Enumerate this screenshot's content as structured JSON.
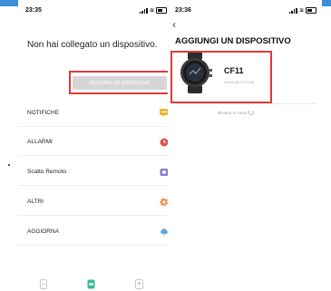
{
  "left_screen": {
    "status_time": "23:35",
    "no_device_title": "Non hai collegato un dispositivo.",
    "add_device_button": "AGGIUNGI UN DISPOSITIVO",
    "menu": [
      {
        "label": "NOTIFICHE",
        "icon": "message-icon",
        "color": "#f2b632"
      },
      {
        "label": "ALLARMI",
        "icon": "alarm-clock-icon",
        "color": "#e2514f"
      },
      {
        "label": "Scatto Remoto",
        "icon": "camera-icon",
        "color": "#8a78d6"
      },
      {
        "label": "ALTRI",
        "icon": "gear-icon",
        "color": "#f08a3c"
      },
      {
        "label": "AGGIORNA",
        "icon": "cloud-upload-icon",
        "color": "#5aa6e6"
      }
    ],
    "tabs": [
      {
        "name": "device",
        "icon": "device-icon"
      },
      {
        "name": "home",
        "icon": "dashboard-icon"
      },
      {
        "name": "profile",
        "icon": "profile-icon"
      }
    ]
  },
  "right_screen": {
    "status_time": "23:36",
    "back_glyph": "‹",
    "title": "AGGIUNGI UN DISPOSITIVO",
    "device": {
      "name": "CF11",
      "mac": "F8:83:66:75:C6:39",
      "image": "smartwatch-icon"
    },
    "searching_text": "Ricerca in corso"
  },
  "colors": {
    "highlight": "#e03a3a",
    "top_bar": "#3f8ed8",
    "disabled_button": "#d6d6d6",
    "tab_active": "#3bb89a"
  }
}
